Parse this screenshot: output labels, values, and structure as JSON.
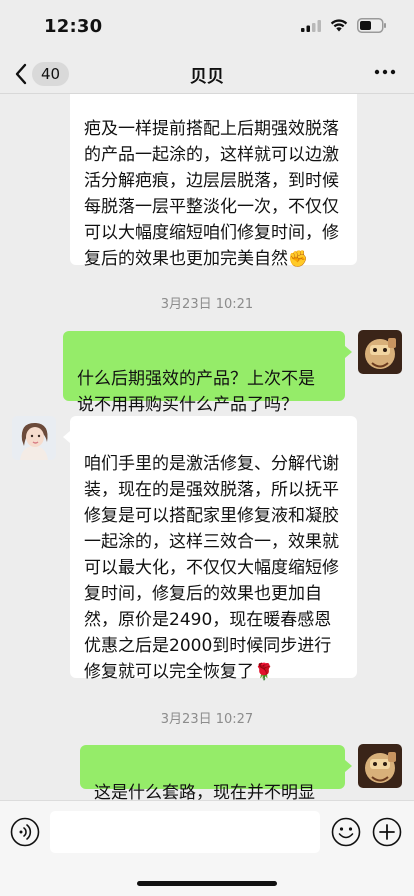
{
  "status": {
    "time": "12:30"
  },
  "header": {
    "back_count": "40",
    "title": "贝贝"
  },
  "messages": [
    {
      "text": "疤及一样提前搭配上后期强效脱落的产品一起涂的，这样就可以边激活分解疤痕，边层层脱落，到时候每脱落一层平整淡化一次，不仅仅可以大幅度缩短咱们修复时间，修复后的效果也更加完美自然",
      "emoji": "✊"
    },
    {
      "timestamp": "3月23日 10:21"
    },
    {
      "text": "什么后期强效的产品？上次不是说不用再购买什么产品了吗？"
    },
    {
      "text": "咱们手里的是激活修复、分解代谢装，现在的是强效脱落，所以抚平修复是可以搭配家里修复液和凝胶一起涂的，这样三效合一，效果就可以最大化，不仅仅大幅度缩短修复时间，修复后的效果也更加自然，原价是2490，现在暖春感恩优惠之后是2000到时候同步进行修复就可以完全恢复了",
      "emoji": "🌹"
    },
    {
      "timestamp": "3月23日 10:27"
    },
    {
      "text": "这是什么套路，现在并不明显"
    }
  ],
  "input": {
    "value": ""
  },
  "icons": {
    "back": "chevron-left-icon",
    "more": "more-dots-icon",
    "voice": "voice-icon",
    "emoji": "emoji-icon",
    "add": "plus-icon"
  },
  "colors": {
    "background": "#ededed",
    "sent_bubble": "#95ec69",
    "received_bubble": "#ffffff",
    "timestamp": "#8c8c8c"
  }
}
